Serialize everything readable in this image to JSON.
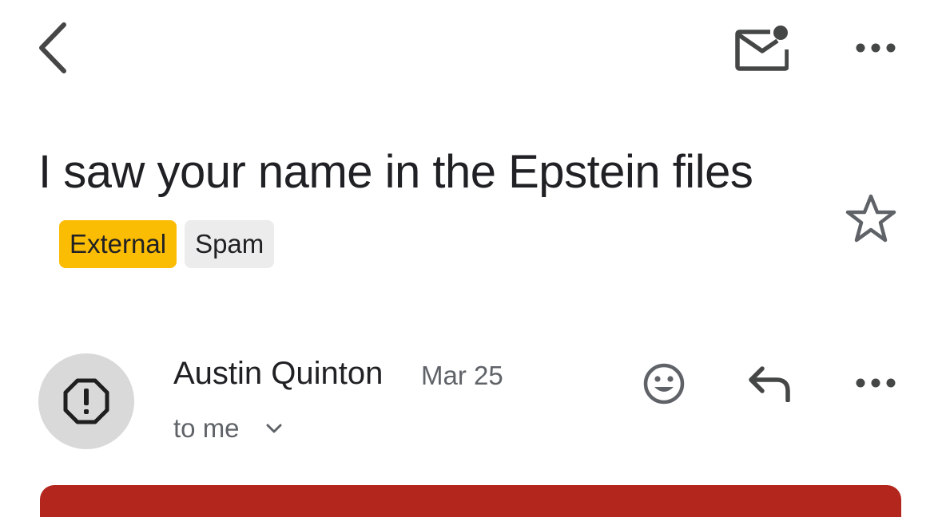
{
  "toolbar": {
    "back_icon": "chevron-left-icon",
    "mark_unread_icon": "mail-unread-icon",
    "more_icon": "more-horiz-icon"
  },
  "email": {
    "subject": "I saw your name in the Epstein files",
    "labels": [
      "External",
      "Spam"
    ],
    "star_icon": "star-outline-icon",
    "sender": "Austin Quinton",
    "date": "Mar 25",
    "recipient": "to me",
    "avatar_icon": "warning-octagon-icon",
    "actions": {
      "react_icon": "emoji-smile-icon",
      "reply_icon": "reply-icon",
      "more_icon": "more-horiz-icon"
    }
  },
  "colors": {
    "external_label": "#fbbc04",
    "spam_label": "#ececec",
    "warning_banner": "#b3261e",
    "icon_gray": "#444746"
  }
}
